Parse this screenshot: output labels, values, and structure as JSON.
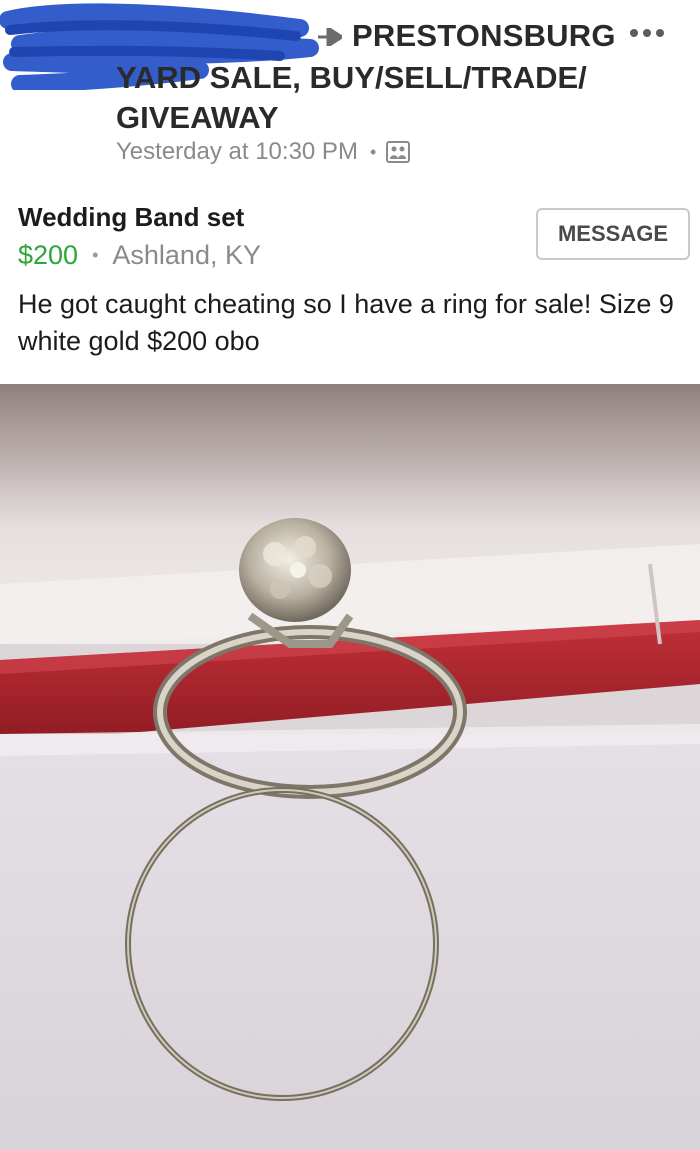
{
  "post": {
    "group_name_line1": "PRESTONSBURG",
    "group_name_line2": "YARD SALE, BUY/SELL/TRADE/ GIVEAWAY",
    "timestamp": "Yesterday at 10:30 PM",
    "audience_icon": "group-audience-icon",
    "more_icon": "more-options-icon"
  },
  "listing": {
    "title": "Wedding Band set",
    "price": "$200",
    "location": "Ashland, KY",
    "message_button": "MESSAGE",
    "description": "He got caught cheating so I have a ring for sale! Size 9 white gold $200 obo"
  },
  "colors": {
    "price_green": "#2ea537",
    "scribble_blue": "#2854c7",
    "box_red": "#b5262f"
  }
}
